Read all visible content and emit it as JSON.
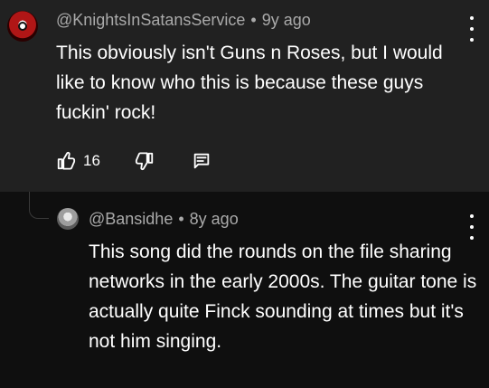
{
  "top_comment": {
    "username": "@KnightsInSatansService",
    "time_ago": "9y ago",
    "separator": "•",
    "text": "This obviously isn't Guns n Roses, but I would like to know who this is because these guys fuckin' rock!",
    "likes": "16",
    "icons": {
      "like": "thumbs-up-icon",
      "dislike": "thumbs-down-icon",
      "reply": "reply-comment-icon",
      "menu": "more-vertical-icon"
    }
  },
  "reply_comment": {
    "username": "@Bansidhe",
    "time_ago": "8y ago",
    "separator": "•",
    "text": "This song did the rounds on the file sharing networks in the early 2000s. The guitar tone is actually quite Finck sounding at times but it's not him singing.",
    "icons": {
      "menu": "more-vertical-icon"
    }
  },
  "colors": {
    "top_bg": "#212121",
    "reply_bg": "#0f0f0f",
    "meta_text": "#aaaaaa",
    "primary_text": "#ffffff",
    "avatar_red": "#b01616"
  }
}
